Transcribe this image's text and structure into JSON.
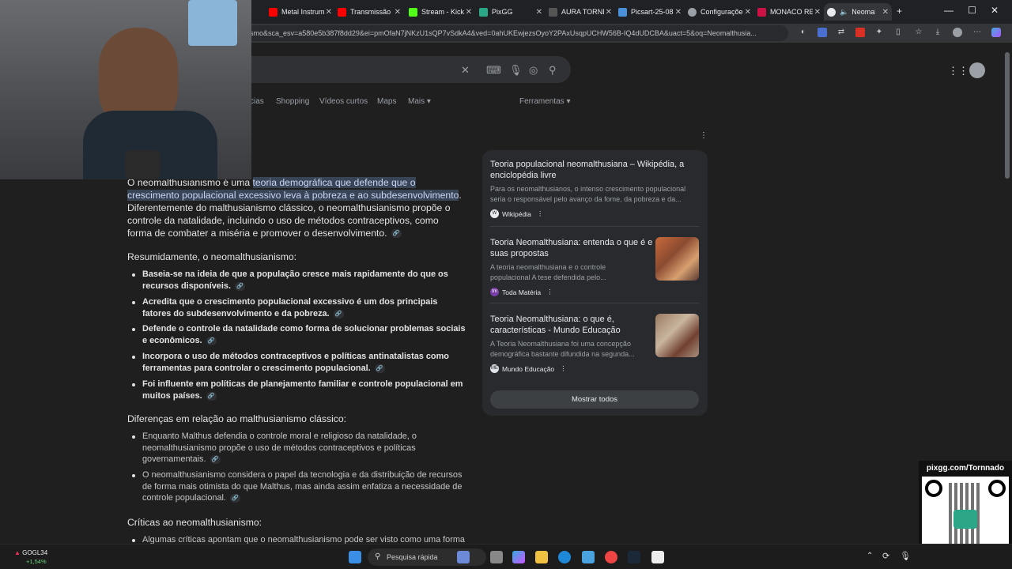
{
  "browser": {
    "tabs": [
      {
        "label": "Metal Instrum",
        "color": "#ff0000"
      },
      {
        "label": "Transmissão",
        "color": "#ff0000"
      },
      {
        "label": "Stream - Kick",
        "color": "#53fc18"
      },
      {
        "label": "PixGG",
        "color": "#2ba687"
      },
      {
        "label": "AURA TORNE",
        "color": "#333333"
      },
      {
        "label": "Picsart-25-08",
        "color": "#4a90d9"
      },
      {
        "label": "Configurações",
        "color": "#9aa0a6"
      },
      {
        "label": "MONACO RE",
        "color": "#cc1144"
      },
      {
        "label": "Neomal",
        "color": "#e8eaed"
      }
    ],
    "url": "smo&sca_esv=a580e5b387f8dd29&ei=pmOfaN7jNKzU1sQP7vSdkA4&ved=0ahUKEwjezsOyoY2PAxUsqpUCHW56B-IQ4dUDCBA&uact=5&oq=Neomalthusia..."
  },
  "search": {
    "nav": [
      "cias",
      "Shopping",
      "Vídeos curtos",
      "Maps",
      "Mais",
      "Ferramentas"
    ]
  },
  "answer": {
    "intro_a": "O neomalthusianismo é uma ",
    "intro_hl1": "teoria demográfica que defende que o",
    "intro_hl2": "crescimento populacional excessivo leva à pobreza e ao subdesenvolvimento",
    "intro_l3": "Diferentemente do malthusianismo clássico, o neomalthusianismo propõe o",
    "intro_l4": "controle da natalidade, incluindo o uso de métodos contraceptivos, como",
    "intro_l5": "forma de combater a miséria e promover o desenvolvimento.",
    "h1": "Resumidamente, o neomalthusianismo:",
    "bullets1": [
      [
        "Baseia-se na ideia de que a população cresce mais rapidamente do que os",
        "recursos disponíveis."
      ],
      [
        "Acredita que o crescimento populacional excessivo é um dos principais",
        "fatores do subdesenvolvimento e da pobreza."
      ],
      [
        "Defende o controle da natalidade como forma de solucionar problemas sociais",
        "e econômicos."
      ],
      [
        "Incorpora o uso de métodos contraceptivos e políticas antinatalistas como",
        "ferramentas para controlar o crescimento populacional."
      ],
      [
        "Foi influente em políticas de planejamento familiar e controle populacional em",
        "muitos países."
      ]
    ],
    "h2": "Diferenças em relação ao malthusianismo clássico:",
    "bullets2": [
      [
        "Enquanto Malthus defendia o controle moral e religioso da natalidade, o",
        "neomalthusianismo propõe o uso de métodos contraceptivos e políticas",
        "governamentais."
      ],
      [
        "O neomalthusianismo considera o papel da tecnologia e da distribuição de recursos",
        "de forma mais otimista do que Malthus, mas ainda assim enfatiza a necessidade de",
        "controle populacional."
      ]
    ],
    "h3": "Críticas ao neomalthusianismo:",
    "bullets3": [
      [
        "Algumas críticas apontam que o neomalthusianismo pode ser visto como uma forma"
      ]
    ]
  },
  "panel": {
    "cards": [
      {
        "title1": "Teoria populacional neomalthusiana – Wikipédia, a",
        "title2": "enciclopédia livre",
        "s1": "Para os neomalthusianos, o intenso crescimento populacional",
        "s2": "seria o responsável pelo avanço da fome, da pobreza e da...",
        "source": "Wikipédia",
        "fav": "W"
      },
      {
        "title1": "Teoria Neomalthusiana: entenda o que é e",
        "title2": "suas propostas",
        "s1": "A teoria neomalthusiana e o controle",
        "s2": "populacional A tese defendida pelo...",
        "source": "Toda Matéria",
        "fav": "tm"
      },
      {
        "title1": "Teoria Neomalthusiana: o que é,",
        "title2": "características - Mundo Educação",
        "s1": "A Teoria Neomalthusiana foi uma concepção",
        "s2": "demográfica bastante difundida na segunda...",
        "source": "Mundo Educação",
        "fav": "ME"
      }
    ],
    "more": "Mostrar todos"
  },
  "overlay": {
    "qr_label": "pixgg.com/Tornnado"
  },
  "taskbar": {
    "stock_name": "GOGL34",
    "stock_change": "+1,54%",
    "search_placeholder": "Pesquisa rápida"
  }
}
